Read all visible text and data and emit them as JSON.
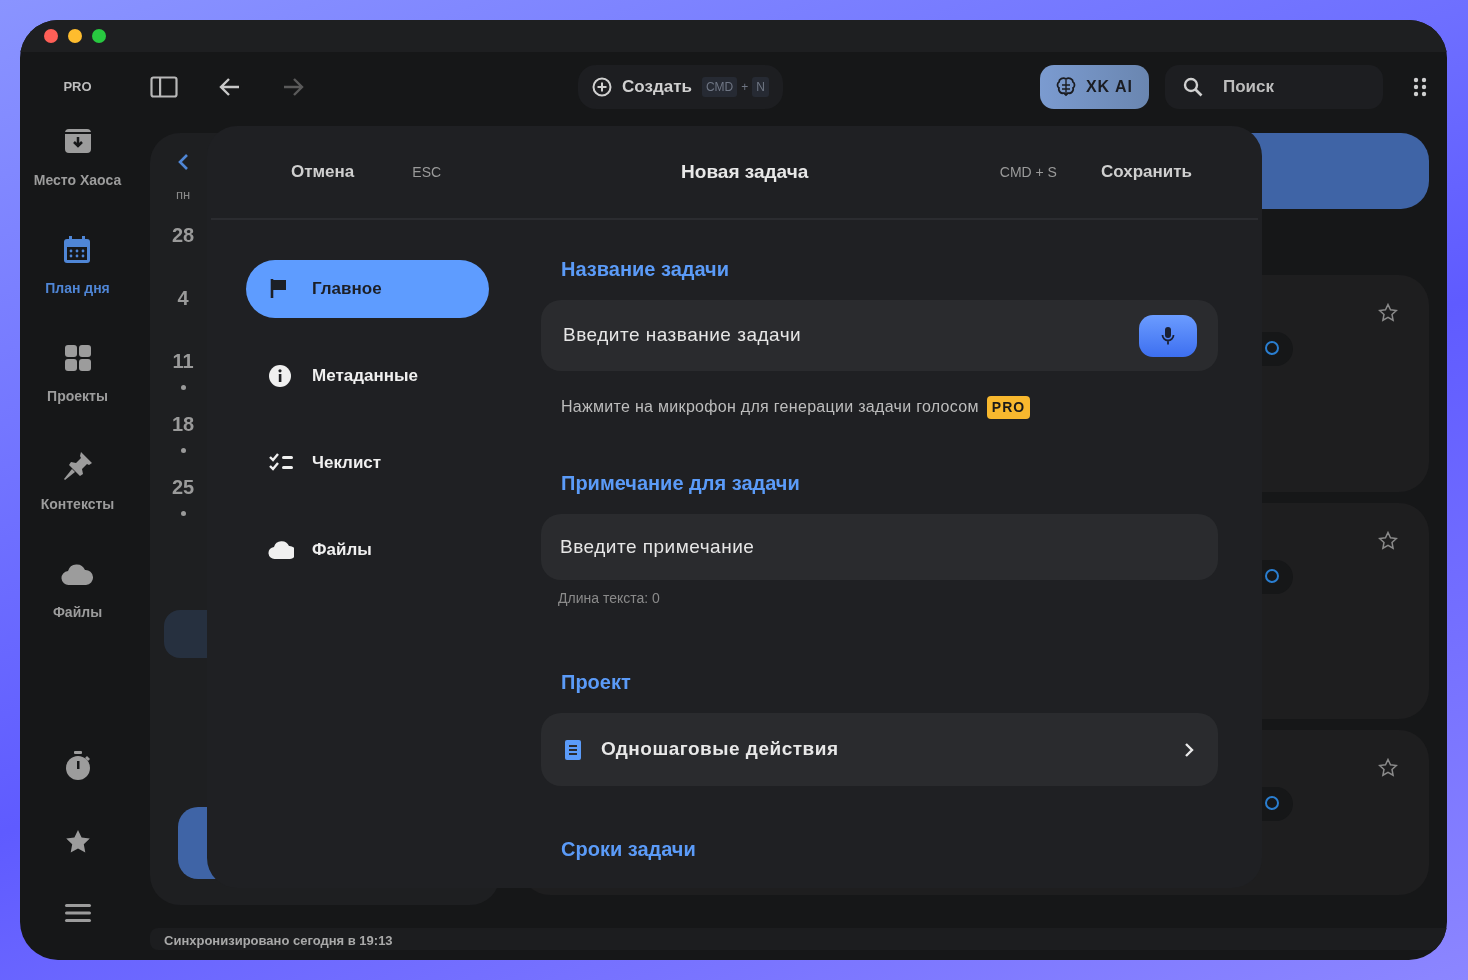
{
  "sidebar": {
    "badge": "PRO",
    "items": [
      {
        "label": "Место Хаоса",
        "selected": false
      },
      {
        "label": "План дня",
        "selected": true
      },
      {
        "label": "Проекты",
        "selected": false
      },
      {
        "label": "Контексты",
        "selected": false
      },
      {
        "label": "Файлы",
        "selected": false
      }
    ]
  },
  "toolbar": {
    "nav": [
      {
        "disabled": false
      },
      {
        "disabled": true
      }
    ],
    "create": {
      "label": "Создать",
      "keys": [
        "CMD",
        "+",
        "N"
      ]
    },
    "ai_button": "XK AI",
    "search": {
      "placeholder": "Поиск"
    }
  },
  "calendar": {
    "weekday": "пн",
    "days": [
      {
        "label": "28",
        "dot": false
      },
      {
        "label": "4",
        "dot": false
      },
      {
        "label": "11",
        "dot": true
      },
      {
        "label": "18",
        "dot": true
      },
      {
        "label": "25",
        "dot": true
      }
    ]
  },
  "modal": {
    "cancel": "Отмена",
    "cancel_shortcut": "ESC",
    "title": "Новая задача",
    "save_shortcut": "CMD + S",
    "save": "Сохранить",
    "nav": [
      {
        "label": "Главное",
        "selected": true
      },
      {
        "label": "Метаданные",
        "selected": false
      },
      {
        "label": "Чеклист",
        "selected": false
      },
      {
        "label": "Файлы",
        "selected": false
      }
    ],
    "name_section": {
      "title": "Название задачи",
      "placeholder": "Введите название задачи",
      "hint": "Нажмите на микрофон для генерации задачи голосом",
      "hint_badge": "PRO"
    },
    "note_section": {
      "title": "Примечание для задачи",
      "placeholder": "Введите примечание",
      "length": "Длина текста: 0"
    },
    "project_section": {
      "title": "Проект",
      "value": "Одношаговые действия"
    },
    "deadline_section": {
      "title": "Сроки задачи"
    }
  },
  "status_bar": "Синхронизировано сегодня в 19:13"
}
